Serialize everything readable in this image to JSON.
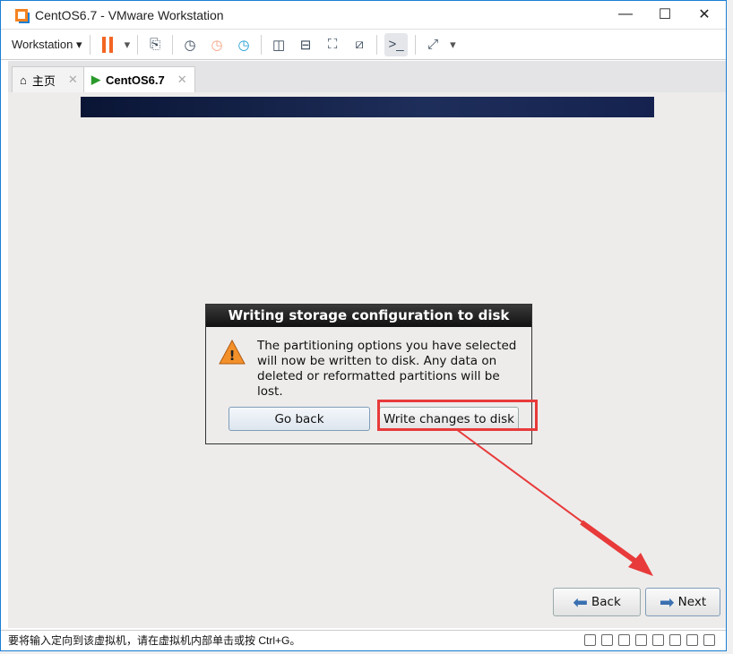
{
  "window": {
    "title": "CentOS6.7 - VMware Workstation",
    "minimize": "—",
    "maximize": "☐",
    "close": "✕"
  },
  "toolbar": {
    "workstation_label": "Workstation",
    "dropdown": "▾"
  },
  "tabs": [
    {
      "label": "主页",
      "close": "✕"
    },
    {
      "label": "CentOS6.7",
      "close": "✕"
    }
  ],
  "dialog": {
    "title": "Writing storage configuration to disk",
    "message": "The partitioning options you have selected will now be written to disk.  Any data on deleted or reformatted partitions will be lost.",
    "go_back": "Go back",
    "write": "Write changes to disk"
  },
  "nav": {
    "back": "Back",
    "next": "Next"
  },
  "status": {
    "text": "要将输入定向到该虚拟机，请在虚拟机内部单击或按 Ctrl+G。"
  },
  "colors": {
    "highlight": "#e83a3a",
    "pause": "#f26522",
    "accent": "#1a7fd4"
  }
}
